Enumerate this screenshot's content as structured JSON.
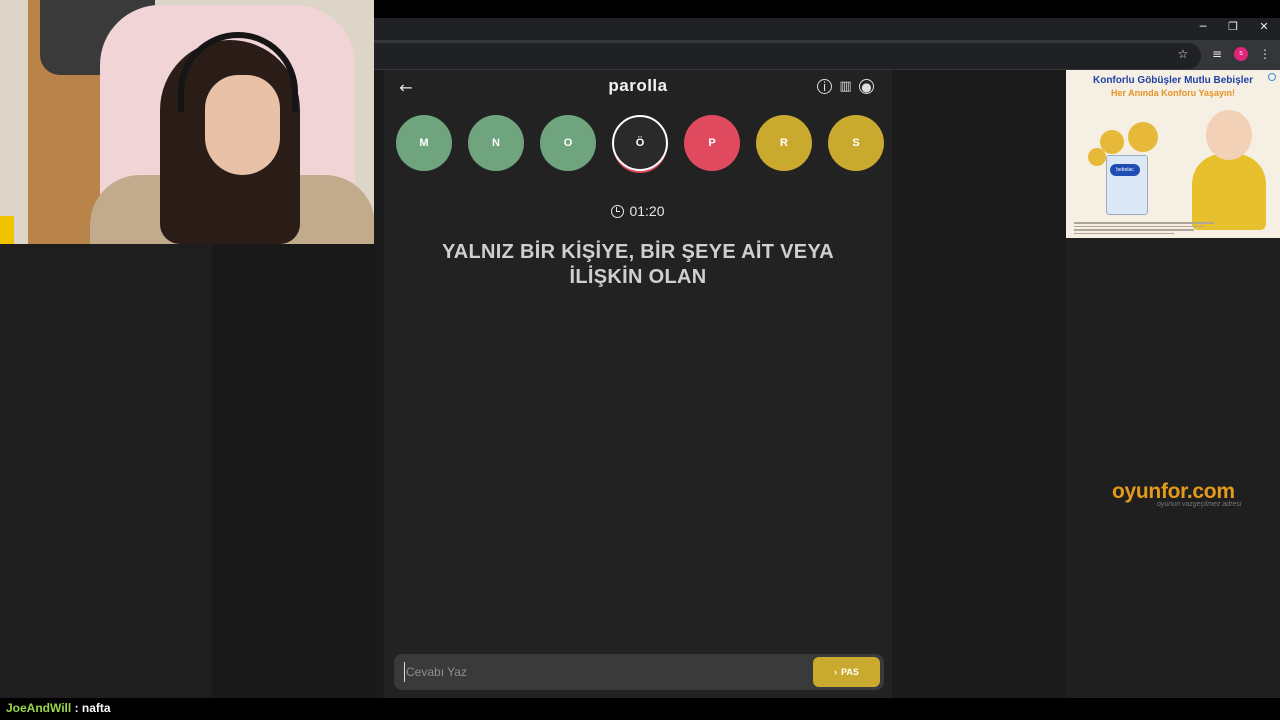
{
  "browser": {
    "window_controls": [
      "─",
      "❐",
      "✕"
    ],
    "toolbar_icons": [
      "star-icon",
      "tab-search-icon",
      "menu-icon"
    ],
    "profile_initial": "s"
  },
  "game": {
    "logo": "parolla",
    "back_icon": "arrow-left-icon",
    "header_icons": [
      "info-icon",
      "stats-icon",
      "account-icon"
    ],
    "letters": [
      {
        "label": "M",
        "state": "correct",
        "color": "#6fa47f"
      },
      {
        "label": "N",
        "state": "correct",
        "color": "#6fa47f"
      },
      {
        "label": "O",
        "state": "correct",
        "color": "#6fa47f"
      },
      {
        "label": "Ö",
        "state": "current",
        "color": "#2a2a2a"
      },
      {
        "label": "P",
        "state": "wrong",
        "color": "#e04a5f"
      },
      {
        "label": "R",
        "state": "passed",
        "color": "#c9aa2f"
      },
      {
        "label": "S",
        "state": "passed",
        "color": "#c9aa2f"
      }
    ],
    "timer": "01:20",
    "question_line1": "YALNIZ BİR KİŞİYE, BİR ŞEYE AİT VEYA",
    "question_line2": "İLİŞKİN OLAN",
    "answer_placeholder": "Cevabı Yaz",
    "pass_label": "PAS",
    "pass_icon": "chevron-right-icon"
  },
  "ad": {
    "title": "Konforlu Göbüşler Mutlu Bebişler",
    "subtitle": "Her Anında Konforu Yaşayın!",
    "product_label": "bebelac"
  },
  "watermark": {
    "brand": "oyunfor.com",
    "tagline": "oyunun vazgeçilmez adresi"
  },
  "chat": {
    "user": "JoeAndWill",
    "message": ": nafta"
  },
  "colors": {
    "correct": "#6fa47f",
    "wrong": "#e04a5f",
    "passed": "#c9aa2f",
    "brand_orange": "#e49a1a"
  }
}
